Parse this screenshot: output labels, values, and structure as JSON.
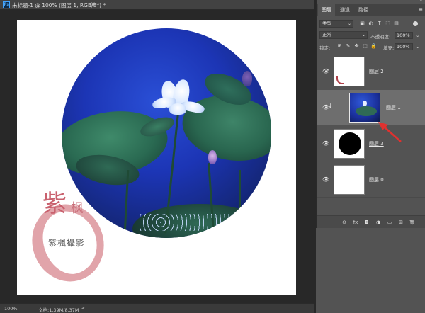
{
  "document": {
    "app_icon": "Ps",
    "title": "未标题-1 @ 100% (图层 1, RGB/8*) *",
    "close_glyph": "×"
  },
  "canvas": {
    "watermark_big": "紫",
    "watermark_small": "枫",
    "watermark_name": "紫楓攝影"
  },
  "status_bar": {
    "zoom": "100%",
    "doc_info": "文档:1.39M/8.37M",
    "arrow": ">"
  },
  "panel": {
    "tabs": [
      "图层",
      "通道",
      "路径"
    ],
    "active_tab": "图层",
    "menu_glyph": "≡",
    "collapse_glyph": "»",
    "filter": {
      "kind_label": "类型",
      "icons": [
        "image-filter-icon",
        "adjustment-filter-icon",
        "type-filter-icon",
        "shape-filter-icon",
        "smart-object-filter-icon"
      ],
      "icon_glyphs": [
        "▣",
        "◐",
        "T",
        "⬚",
        "▤"
      ]
    },
    "blend_mode": "正常",
    "opacity_label": "不透明度:",
    "opacity_value": "100%",
    "lock_label": "锁定:",
    "lock_glyphs": [
      "⊞",
      "✎",
      "✥",
      "⬚",
      "🔒"
    ],
    "fill_label": "填充:",
    "fill_value": "100%",
    "caret": "⌄"
  },
  "layers": [
    {
      "name": "图层 2",
      "visible_glyph": "👁",
      "thumb": "transparent-with-red",
      "selected": false,
      "underlined": false
    },
    {
      "name": "图层 1",
      "visible_glyph": "👁",
      "thumb": "photo",
      "selected": true,
      "underlined": false,
      "clip_glyph": "↓"
    },
    {
      "name": "图层 3",
      "visible_glyph": "👁",
      "thumb": "black-circle",
      "selected": false,
      "underlined": true
    },
    {
      "name": "图层 0",
      "visible_glyph": "👁",
      "thumb": "white",
      "selected": false,
      "underlined": false
    }
  ],
  "footer_icons": {
    "names": [
      "link-layers-icon",
      "fx-icon",
      "mask-icon",
      "adjustment-icon",
      "group-icon",
      "new-layer-icon",
      "delete-icon"
    ],
    "glyphs": [
      "⊖",
      "fx",
      "◘",
      "◑",
      "▭",
      "⊞",
      "🗑"
    ]
  },
  "colors": {
    "panel_bg": "#535353",
    "selected_row": "#6e6e6e",
    "arrow_red": "#e0312f",
    "sky_blue": "#1c35b5"
  }
}
